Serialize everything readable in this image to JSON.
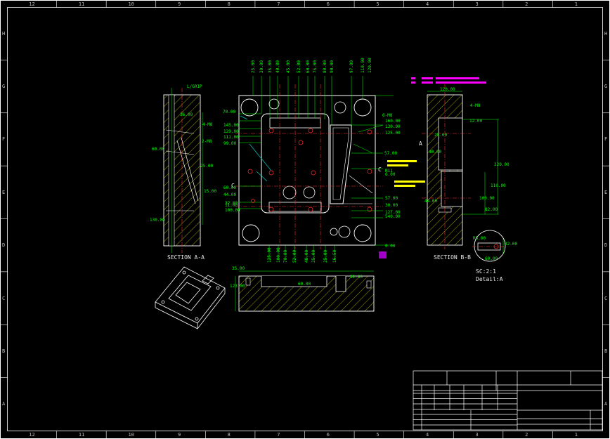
{
  "sheet": {
    "column_numbers": [
      "12",
      "11",
      "10",
      "9",
      "8",
      "7",
      "6",
      "5",
      "4",
      "3",
      "2",
      "1"
    ],
    "row_letters": [
      "H",
      "G",
      "F",
      "E",
      "D",
      "C",
      "B",
      "A"
    ]
  },
  "views": {
    "section_aa_label": "SECTION A-A",
    "section_bb_label": "SECTION B-B",
    "detail_scale": "SC:2:1",
    "detail_name": "Detail:A",
    "cut_c_left": "C",
    "cut_c_right": "C",
    "cut_a": "A",
    "cut_b": "B"
  },
  "dimensions": {
    "plan_top": [
      "25.00",
      "30.00",
      "35.00",
      "40.00",
      "45.00",
      "52.00",
      "60.00",
      "75.00",
      "80.00",
      "90.00",
      "97.00",
      "110.00",
      "120.00"
    ],
    "plan_left": [
      "70.00",
      "145.00",
      "129.00",
      "111.00",
      "99.00",
      "60.00",
      "44.00",
      "32.00",
      "11.00",
      "100.00"
    ],
    "plan_right": [
      "6-M8",
      "160.00",
      "130.00",
      "125.00",
      "57.00",
      "R11",
      "6.00",
      "57.00",
      "30.00",
      "127.00",
      "540.00",
      "0.00"
    ],
    "plan_bottom": [
      "125.00",
      "100.00",
      "70.00",
      "52.00",
      "48.00",
      "35.00",
      "25.00",
      "16.50"
    ],
    "section_bb": [
      "120.00",
      "4-M8",
      "12.00",
      "40.00",
      "25.00",
      "220.00",
      "110.00",
      "100.00",
      "82.00",
      "44.00"
    ],
    "section_aa": [
      "L/GRIP",
      "36.00",
      "4-M8",
      "2-M8",
      "60.00",
      "25.00",
      "15.00",
      "130.00"
    ],
    "front_view": [
      "123.00",
      "35.00",
      "60.00",
      "32.00"
    ],
    "detail": [
      "R5.00",
      "32.00",
      "60.00"
    ]
  },
  "title_block": {
    "part_name": "",
    "material": "",
    "scale": "",
    "drawing_no": ""
  },
  "colors": {
    "border": "#ffffff",
    "outline": "#ffffff",
    "dimension": "#00ff00",
    "hatch": "#c8c800",
    "center": "#ff3030",
    "leader": "#00c8c8",
    "callout": "#ffff00",
    "tag": "#ff00ff"
  }
}
